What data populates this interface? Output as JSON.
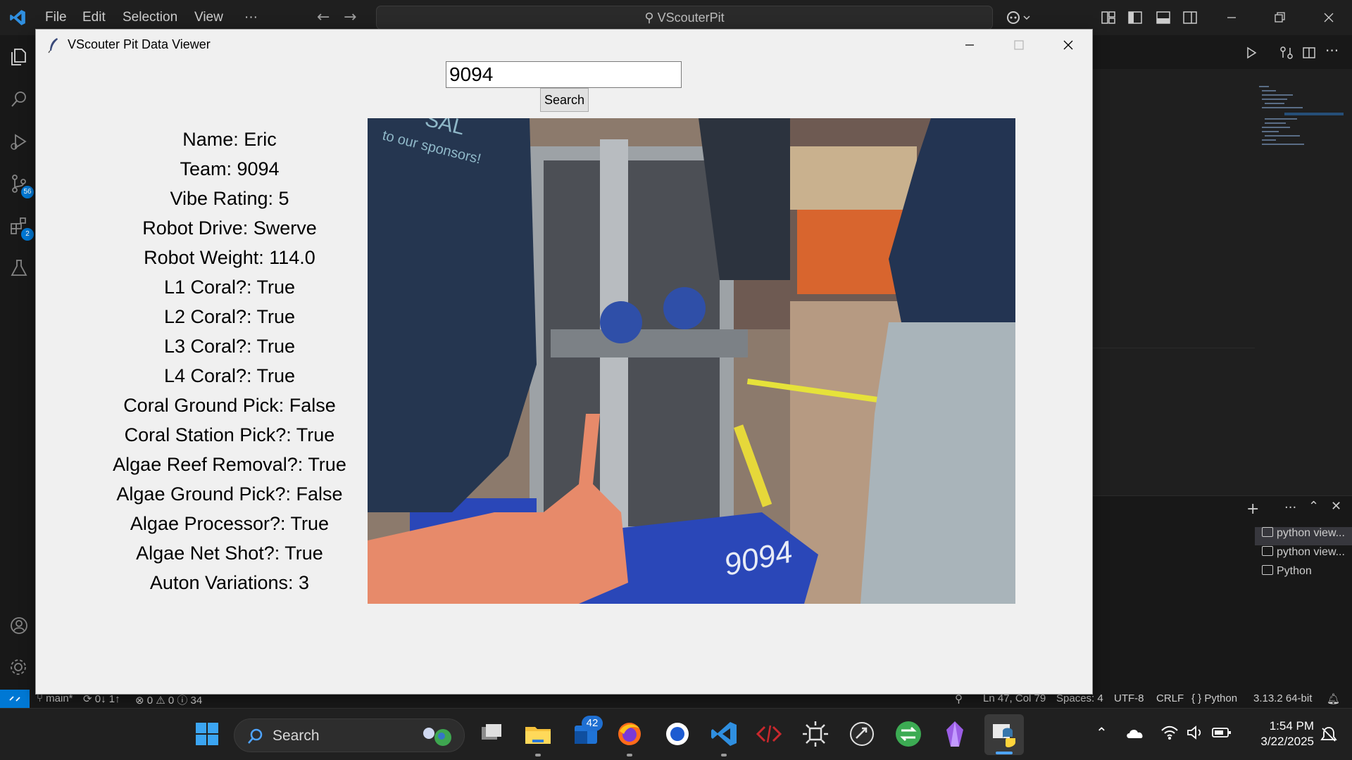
{
  "vscode": {
    "menu": [
      "File",
      "Edit",
      "Selection",
      "View",
      "···"
    ],
    "command_center": "VScouterPit",
    "activity_badges": {
      "source_control": "56",
      "extensions": "2"
    },
    "terminals": [
      "python view...",
      "python view...",
      "Python"
    ],
    "status": {
      "branch": "main*",
      "sync": "0↓ 1↑",
      "problems": "⊗ 0 ⚠ 0 ⓘ 34",
      "position": "Ln 47, Col 79",
      "spaces": "Spaces: 4",
      "encoding": "UTF-8",
      "eol": "CRLF",
      "language": "{ } Python",
      "interpreter": "3.13.2 64-bit"
    }
  },
  "app": {
    "title": "VScouter Pit Data Viewer",
    "search_value": "9094",
    "search_label": "Search",
    "fields": [
      "Name: Eric",
      "Team: 9094",
      "Vibe Rating: 5",
      "Robot Drive: Swerve",
      "Robot Weight: 114.0",
      "L1 Coral?: True",
      "L2 Coral?: True",
      "L3 Coral?: True",
      "L4 Coral?: True",
      "Coral Ground Pick: False",
      "Coral Station Pick?: True",
      "Algae Reef Removal?: True",
      "Algae Ground Pick?: False",
      "Algae Processor?: True",
      "Algae Net Shot?: True",
      "Auton Variations: 3"
    ],
    "photo_text": {
      "shirt": "to our sponsors!",
      "shirt_top": "SAL",
      "bumper": "9094"
    }
  },
  "taskbar": {
    "search_placeholder": "Search",
    "mail_badge": "42",
    "time": "1:54 PM",
    "date": "3/22/2025"
  }
}
